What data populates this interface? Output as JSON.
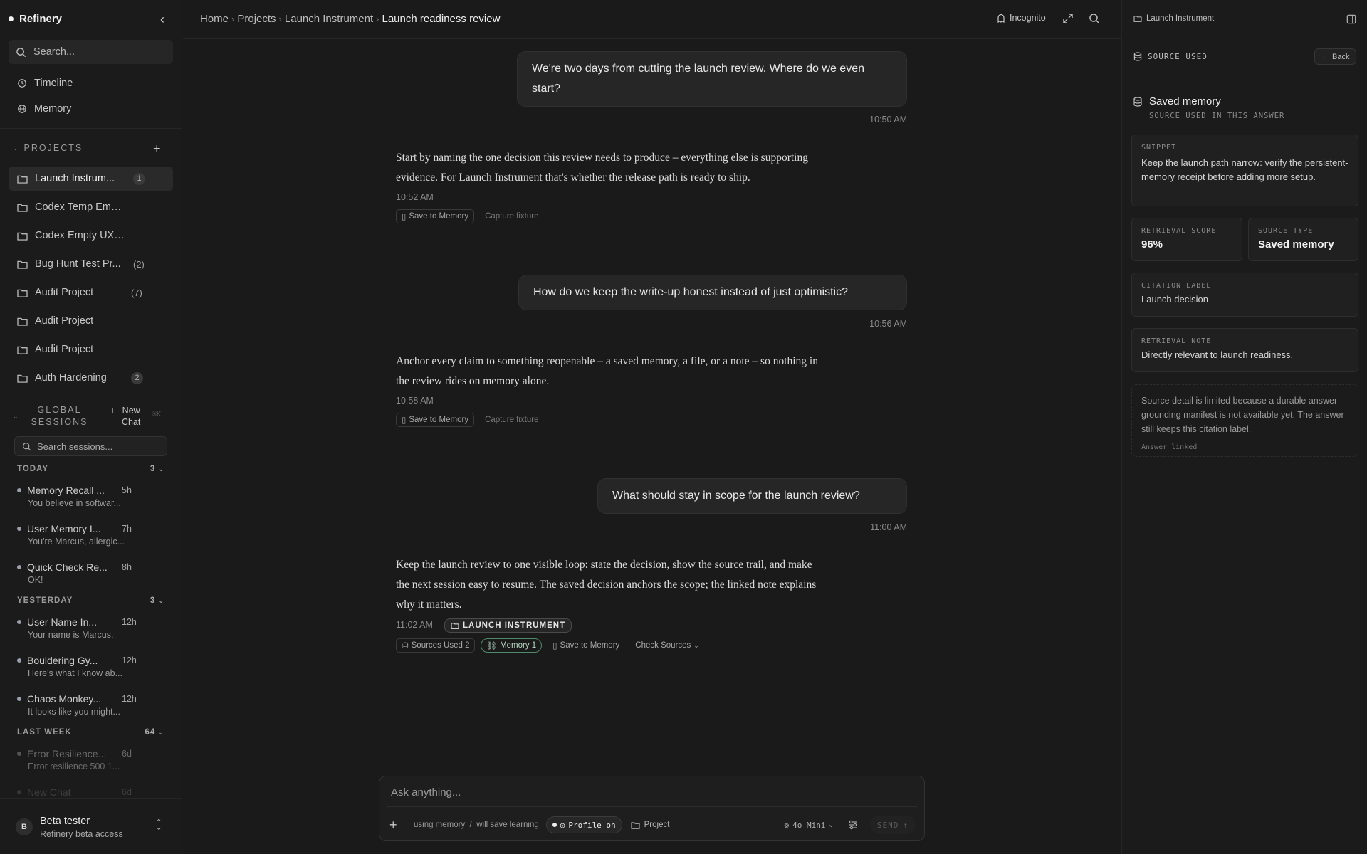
{
  "sidebar": {
    "brand": "Refinery",
    "search_placeholder": "Search...",
    "nav": [
      {
        "label": "Timeline",
        "icon": "history-icon"
      },
      {
        "label": "Memory",
        "icon": "globe-icon"
      }
    ],
    "projects_heading": "PROJECTS",
    "projects": [
      {
        "name": "Launch Instrum...",
        "count": "1",
        "count_style": "badge",
        "active": true
      },
      {
        "name": "Codex Temp Empt...",
        "count": "",
        "count_style": "none"
      },
      {
        "name": "Codex Empty UX C...",
        "count": "",
        "count_style": "none"
      },
      {
        "name": "Bug Hunt Test Pr...",
        "count": "(2)",
        "count_style": "paren"
      },
      {
        "name": "Audit Project",
        "count": "(7)",
        "count_style": "paren"
      },
      {
        "name": "Audit Project",
        "count": "",
        "count_style": "none"
      },
      {
        "name": "Audit Project",
        "count": "",
        "count_style": "none"
      },
      {
        "name": "Auth Hardening",
        "count": "2",
        "count_style": "badge"
      }
    ],
    "global_sessions_heading": "GLOBAL SESSIONS",
    "new_chat_label": "New Chat",
    "new_chat_shortcut": "⌘K",
    "session_search_placeholder": "Search sessions...",
    "groups": {
      "today": {
        "label": "TODAY",
        "count": "3"
      },
      "yesterday": {
        "label": "YESTERDAY",
        "count": "3"
      },
      "last_week": {
        "label": "LAST WEEK",
        "count": "64"
      }
    },
    "sessions": [
      {
        "title": "Memory Recall ...",
        "time": "5h",
        "preview": "You believe in softwar..."
      },
      {
        "title": "User Memory I...",
        "time": "7h",
        "preview": "You're Marcus, allergic..."
      },
      {
        "title": "Quick Check Re...",
        "time": "8h",
        "preview": "OK!"
      },
      {
        "title": "User Name In...",
        "time": "12h",
        "preview": "Your name is Marcus."
      },
      {
        "title": "Bouldering Gy...",
        "time": "12h",
        "preview": "Here's what I know ab..."
      },
      {
        "title": "Chaos Monkey...",
        "time": "12h",
        "preview": "It looks like you might..."
      },
      {
        "title": "Error Resilience...",
        "time": "6d",
        "preview": "Error resilience 500 1..."
      },
      {
        "title": "New Chat",
        "time": "6d",
        "preview": ""
      }
    ],
    "user": {
      "initial": "B",
      "name": "Beta tester",
      "subtitle": "Refinery beta access"
    }
  },
  "header": {
    "breadcrumbs": [
      "Home",
      "Projects",
      "Launch Instrument"
    ],
    "current": "Launch readiness review",
    "incognito_label": "Incognito"
  },
  "chat": {
    "messages": [
      {
        "user": "We're two days from cutting the launch review. Where do we even start?",
        "user_time": "10:50 AM",
        "answer": "Start by naming the one decision this review needs to produce – everything else is supporting evidence. For Launch Instrument that's whether the release path is ready to ship.",
        "answer_time": "10:52 AM"
      },
      {
        "user": "How do we keep the write-up honest instead of just optimistic?",
        "user_time": "10:56 AM",
        "answer": "Anchor every claim to something reopenable – a saved memory, a file, or a note – so nothing in the review rides on memory alone.",
        "answer_time": "10:58 AM"
      },
      {
        "user": "What should stay in scope for the launch review?",
        "user_time": "11:00 AM",
        "answer": "Keep the launch review to one visible loop: state the decision, show the source trail, and make the next session easy to resume. The saved decision anchors the scope; the linked note explains why it matters.",
        "answer_time": "11:02 AM"
      }
    ],
    "save_to_memory": "Save to Memory",
    "capture_fixture": "Capture fixture",
    "project_tag": "LAUNCH INSTRUMENT",
    "sources_used": "Sources Used 2",
    "memory_chip": "Memory 1",
    "check_sources": "Check Sources"
  },
  "composer": {
    "placeholder": "Ask anything...",
    "memory_status": "using memory",
    "learning_status": "will save learning",
    "profile_label": "Profile on",
    "project_label": "Project",
    "model": "4o Mini",
    "send_label": "SEND"
  },
  "right_panel": {
    "project": "Launch Instrument",
    "header": "SOURCE USED",
    "back_label": "Back",
    "source_title": "Saved memory",
    "source_subtitle": "SOURCE USED IN THIS ANSWER",
    "snippet_label": "SNIPPET",
    "snippet_text": "Keep the launch path narrow: verify the persistent-memory receipt before adding more setup.",
    "retrieval_score_label": "RETRIEVAL SCORE",
    "retrieval_score": "96%",
    "source_type_label": "SOURCE TYPE",
    "source_type": "Saved memory",
    "citation_label_label": "CITATION LABEL",
    "citation_label": "Launch decision",
    "retrieval_note_label": "RETRIEVAL NOTE",
    "retrieval_note": "Directly relevant to launch readiness.",
    "limit_note": "Source detail is limited because a durable answer grounding manifest is not available yet. The answer still keeps this citation label.",
    "answer_linked": "Answer linked"
  },
  "colors": {
    "background": "#1a1a1a",
    "accent_green": "#4f8a6a",
    "text": "#e6e6e6"
  }
}
